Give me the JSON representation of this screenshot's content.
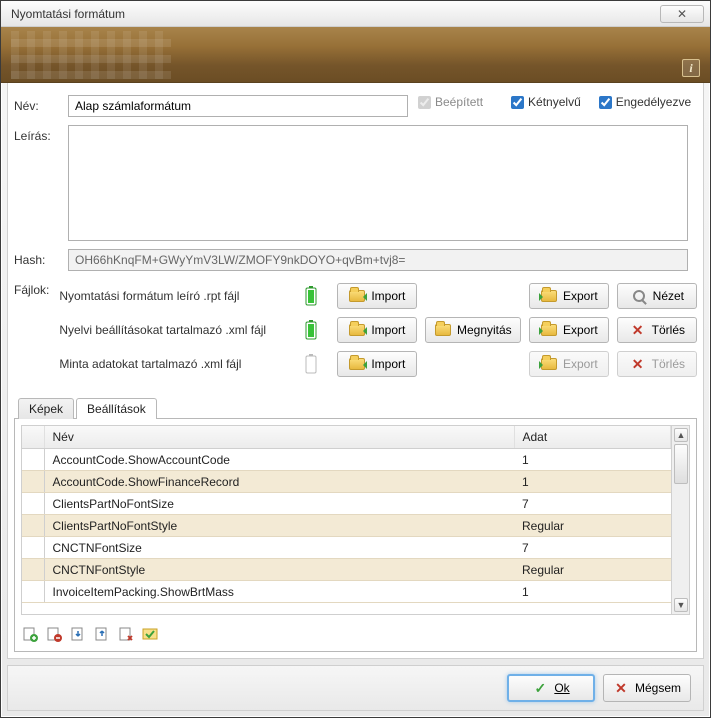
{
  "window": {
    "title": "Nyomtatási formátum"
  },
  "form": {
    "name_label": "Név:",
    "name_value": "Alap számlaformátum",
    "builtin_label": "Beépített",
    "builtin_checked": true,
    "bilingual_label": "Kétnyelvű",
    "bilingual_checked": true,
    "enabled_label": "Engedélyezve",
    "enabled_checked": true,
    "desc_label": "Leírás:",
    "desc_value": "",
    "hash_label": "Hash:",
    "hash_value": "OH66hKnqFM+GWyYmV3LW/ZMOFY9nkDOYO+qvBm+tvj8=",
    "files_label": "Fájlok:"
  },
  "files": {
    "rows": [
      {
        "label": "Nyomtatási formátum leíró .rpt fájl",
        "level": "full",
        "import": true,
        "open": false,
        "export": true,
        "view": "Nézet",
        "view_enabled": true,
        "delete": false
      },
      {
        "label": "Nyelvi beállításokat tartalmazó .xml fájl",
        "level": "full",
        "import": true,
        "open": true,
        "export": true,
        "delete": true
      },
      {
        "label": "Minta adatokat tartalmazó .xml fájl",
        "level": "empty",
        "import": true,
        "open": false,
        "export": false,
        "delete": false
      }
    ],
    "btn_import": "Import",
    "btn_open": "Megnyitás",
    "btn_export": "Export",
    "btn_view": "Nézet",
    "btn_delete": "Törlés"
  },
  "tabs": {
    "images": "Képek",
    "settings": "Beállítások",
    "active": "settings"
  },
  "grid": {
    "col_name": "Név",
    "col_data": "Adat",
    "rows": [
      {
        "name": "AccountCode.ShowAccountCode",
        "data": "1"
      },
      {
        "name": "AccountCode.ShowFinanceRecord",
        "data": "1"
      },
      {
        "name": "ClientsPartNoFontSize",
        "data": "7"
      },
      {
        "name": "ClientsPartNoFontStyle",
        "data": "Regular"
      },
      {
        "name": "CNCTNFontSize",
        "data": "7"
      },
      {
        "name": "CNCTNFontStyle",
        "data": "Regular"
      },
      {
        "name": "InvoiceItemPacking.ShowBrtMass",
        "data": "1"
      }
    ]
  },
  "footer": {
    "ok": "Ok",
    "cancel": "Mégsem"
  }
}
